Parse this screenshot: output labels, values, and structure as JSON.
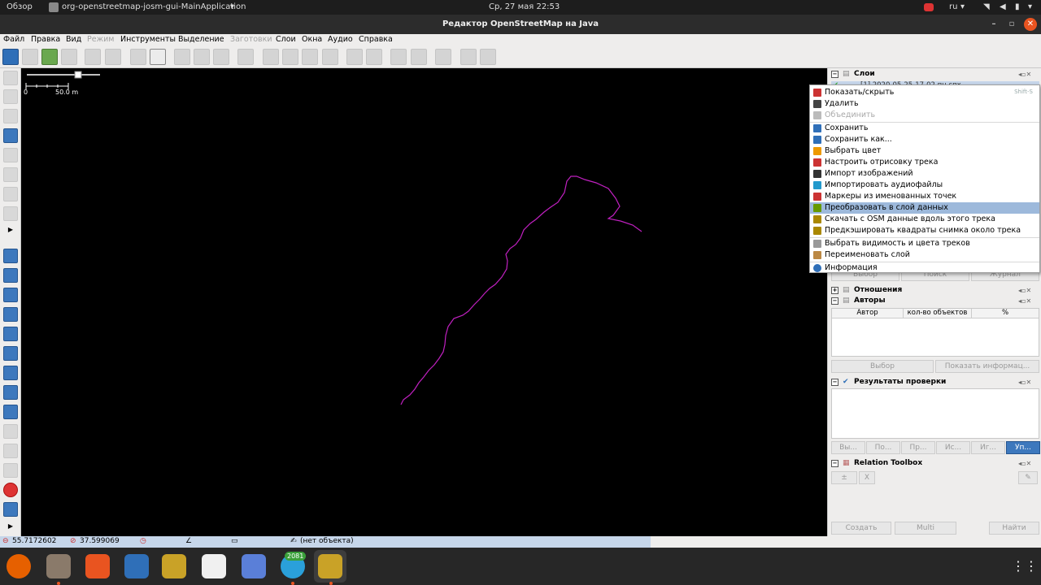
{
  "topbar": {
    "activities": "Обзор",
    "app_menu": "org-openstreetmap-josm-gui-MainApplication",
    "clock": "Ср, 27 мая  22:53",
    "lang": "ru"
  },
  "window": {
    "title": "Редактор OpenStreetMap на Java"
  },
  "menubar": {
    "items": [
      {
        "label": "Файл",
        "enabled": true
      },
      {
        "label": "Правка",
        "enabled": true
      },
      {
        "label": "Вид",
        "enabled": true
      },
      {
        "label": "Режим",
        "enabled": false
      },
      {
        "label": "Инструменты",
        "enabled": true
      },
      {
        "label": "Выделение",
        "enabled": true
      },
      {
        "label": "Заготовки",
        "enabled": false
      },
      {
        "label": "Слои",
        "enabled": true
      },
      {
        "label": "Окна",
        "enabled": true
      },
      {
        "label": "Аудио",
        "enabled": true
      },
      {
        "label": "Справка",
        "enabled": true
      }
    ]
  },
  "map": {
    "scale_zero": "0",
    "scale_value": "50.0 m",
    "zoom_slider": 0.7,
    "track_color": "#c020c0"
  },
  "layers_panel": {
    "title": "Слои",
    "layer_item": "[1] 2020-05-25-17-02 пн спх"
  },
  "context_menu": {
    "items": [
      {
        "label": "Показать/скрыть",
        "shortcut": "Shift-S",
        "icon": "show-hide-icon"
      },
      {
        "label": "Удалить",
        "icon": "delete-icon"
      },
      {
        "label": "Объединить",
        "disabled": true,
        "icon": "merge-icon"
      },
      {
        "sep": true
      },
      {
        "label": "Сохранить",
        "icon": "save-icon"
      },
      {
        "label": "Сохранить как...",
        "icon": "save-as-icon"
      },
      {
        "label": "Выбрать цвет",
        "icon": "color-icon"
      },
      {
        "label": "Настроить отрисовку трека",
        "icon": "track-draw-icon"
      },
      {
        "label": "Импорт изображений",
        "icon": "camera-icon"
      },
      {
        "label": "Импортировать аудиофайлы",
        "icon": "audio-icon"
      },
      {
        "label": "Маркеры из именованных точек",
        "icon": "marker-icon"
      },
      {
        "label": "Преобразовать в слой данных",
        "highlight": true,
        "icon": "convert-icon"
      },
      {
        "label": "Скачать с OSM данные вдоль этого трека",
        "icon": "download-along-icon"
      },
      {
        "label": "Предкэшировать квадраты снимка около трека",
        "icon": "precache-icon"
      },
      {
        "sep": true
      },
      {
        "label": "Выбрать видимость и цвета треков",
        "icon": "filter-icon"
      },
      {
        "label": "Переименовать слой",
        "icon": "rename-icon"
      },
      {
        "sep": true
      },
      {
        "label": "Информация",
        "icon": "info-icon"
      }
    ]
  },
  "selection_buttons": {
    "select": "Выбор",
    "search": "Поиск",
    "history": "Журнал"
  },
  "relations_panel": {
    "title": "Отношения"
  },
  "authors_panel": {
    "title": "Авторы",
    "columns": [
      "Автор",
      "кол-во объектов",
      "%"
    ],
    "select": "Выбор",
    "show_info": "Показать информац..."
  },
  "validation_panel": {
    "title": "Результаты проверки",
    "buttons": [
      "Вы...",
      "По...",
      "Пр...",
      "Ис...",
      "Иг...",
      "Уп..."
    ]
  },
  "relation_toolbox": {
    "title": "Relation Toolbox",
    "plus": "±",
    "x": "X",
    "create": "Создать",
    "multi": "Multi",
    "find": "Найти"
  },
  "statusbar": {
    "lat": "55.7172602",
    "lon": "37.599069",
    "object": "(нет объекта)"
  },
  "dock": {
    "telegram_badge": "2081"
  },
  "colors": {
    "menu_highlight": "#9db9db",
    "accent": "#3d78bd",
    "track": "#c020c0"
  }
}
